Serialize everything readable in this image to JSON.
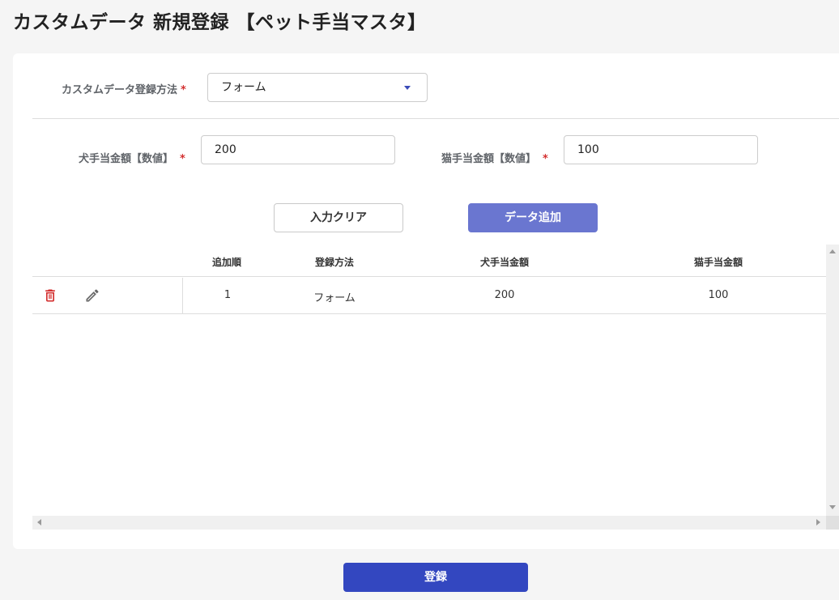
{
  "page": {
    "title": "カスタムデータ 新規登録 【ペット手当マスタ】"
  },
  "form": {
    "method_label": "カスタムデータ登録方法",
    "required_mark": "*",
    "method_value": "フォーム",
    "dog_label": "犬手当金額【数値】",
    "dog_value": "200",
    "cat_label": "猫手当金額【数値】",
    "cat_value": "100"
  },
  "buttons": {
    "clear": "入力クリア",
    "add": "データ追加",
    "submit": "登録"
  },
  "table": {
    "headers": [
      "追加順",
      "登録方法",
      "犬手当金額",
      "猫手当金額"
    ],
    "rows": [
      [
        "1",
        "フォーム",
        "200",
        "100"
      ]
    ]
  },
  "colors": {
    "primary": "#3347c0",
    "primary_light": "#6a76d0",
    "required": "#d32f2f",
    "delete_icon": "#d32f2f"
  },
  "icons": {
    "row_delete": "trash-icon",
    "row_edit": "pencil-icon",
    "select_caret": "caret-down-icon"
  }
}
